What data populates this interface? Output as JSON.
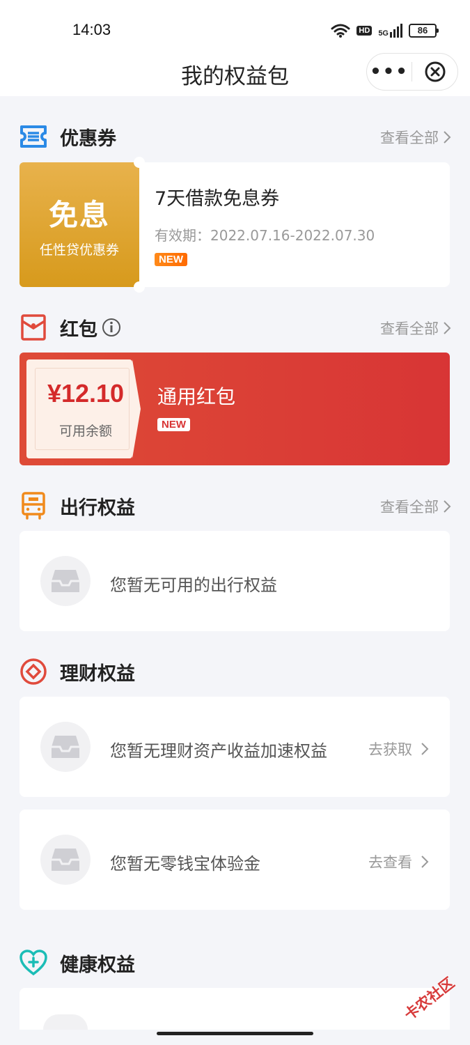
{
  "status_bar": {
    "time": "14:03",
    "network": "5G",
    "hd": "HD",
    "battery": "86"
  },
  "nav": {
    "title": "我的权益包"
  },
  "coupons": {
    "title": "优惠券",
    "more": "查看全部",
    "item": {
      "tag_big": "免息",
      "tag_small": "任性贷优惠券",
      "name": "7天借款免息券",
      "valid": "有效期：2022.07.16-2022.07.30",
      "badge": "NEW"
    }
  },
  "red_packet": {
    "title": "红包",
    "more": "查看全部",
    "item": {
      "amount": "¥12.10",
      "amount_label": "可用余额",
      "name": "通用红包",
      "badge": "NEW"
    }
  },
  "travel": {
    "title": "出行权益",
    "more": "查看全部",
    "empty_text": "您暂无可用的出行权益"
  },
  "finance": {
    "title": "理财权益",
    "rows": [
      {
        "text": "您暂无理财资产收益加速权益",
        "action": "去获取"
      },
      {
        "text": "您暂无零钱宝体验金",
        "action": "去查看"
      }
    ]
  },
  "health": {
    "title": "健康权益"
  },
  "watermark": "卡农社区",
  "colors": {
    "coupon_gold": "#d79a1c",
    "red_packet": "#d83535",
    "badge_orange": "#ff6a00",
    "icon_blue": "#2b8ae6",
    "icon_red": "#e04a3c",
    "icon_orange": "#f08a1c",
    "icon_teal": "#1bbdb6"
  }
}
